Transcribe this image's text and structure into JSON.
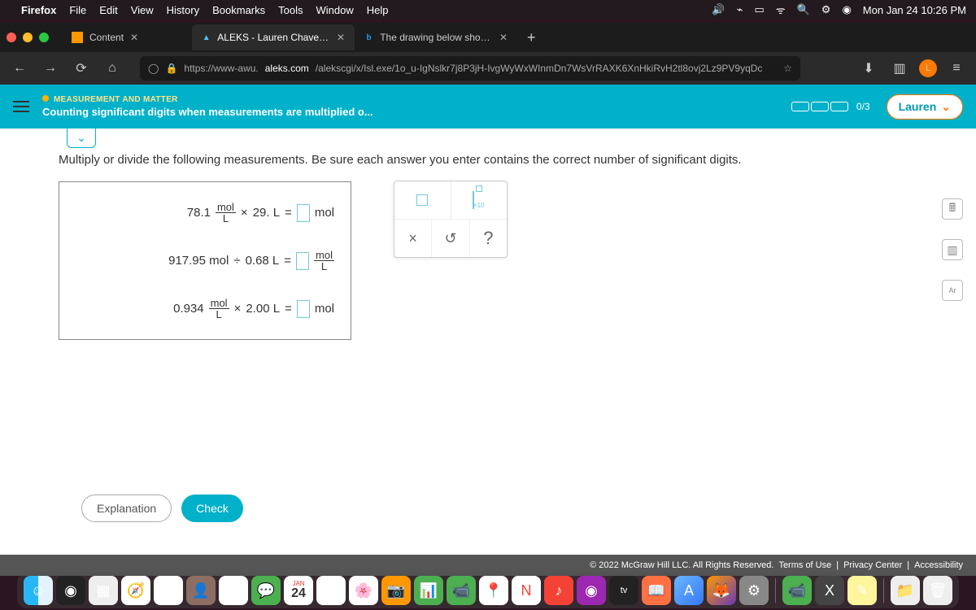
{
  "menubar": {
    "app": "Firefox",
    "items": [
      "File",
      "Edit",
      "View",
      "History",
      "Bookmarks",
      "Tools",
      "Window",
      "Help"
    ],
    "datetime": "Mon Jan 24  10:26 PM"
  },
  "tabs": {
    "t0": {
      "label": "Content"
    },
    "t1": {
      "label": "ALEKS - Lauren Chavez - Learn"
    },
    "t2": {
      "label": "The drawing below shows a mixt"
    }
  },
  "url": {
    "prefix": "https://www-awu.",
    "domain": "aleks.com",
    "path": "/alekscgi/x/Isl.exe/1o_u-IgNslkr7j8P3jH-IvgWyWxWInmDn7WsVrRAXK6XnHkiRvH2tl8ovj2Lz9PV9yqDc"
  },
  "aleks": {
    "category": "MEASUREMENT AND MATTER",
    "title": "Counting significant digits when measurements are multiplied o...",
    "progress": "0/3",
    "user": "Lauren",
    "instruction": "Multiply or divide the following measurements. Be sure each answer you enter contains the correct number of significant digits.",
    "p1": {
      "a": "78.1",
      "unit_n": "mol",
      "unit_d": "L",
      "op": "×",
      "b": "29. L",
      "eq": "=",
      "runit": "mol"
    },
    "p2": {
      "a": "917.95 mol",
      "op": "÷",
      "b": "0.68 L",
      "eq": "=",
      "runit_n": "mol",
      "runit_d": "L"
    },
    "p3": {
      "a": "0.934",
      "unit_n": "mol",
      "unit_d": "L",
      "op": "×",
      "b": "2.00 L",
      "eq": "=",
      "runit": "mol"
    },
    "tools": {
      "x10": "×10",
      "times": "×",
      "reset": "↺",
      "help": "?"
    },
    "explanation": "Explanation",
    "check": "Check"
  },
  "footer": {
    "copyright": "© 2022 McGraw Hill LLC. All Rights Reserved.",
    "terms": "Terms of Use",
    "privacy": "Privacy Center",
    "accessibility": "Accessibility"
  },
  "dock": {
    "cal_month": "JAN",
    "cal_day": "24",
    "tv": "tv"
  }
}
